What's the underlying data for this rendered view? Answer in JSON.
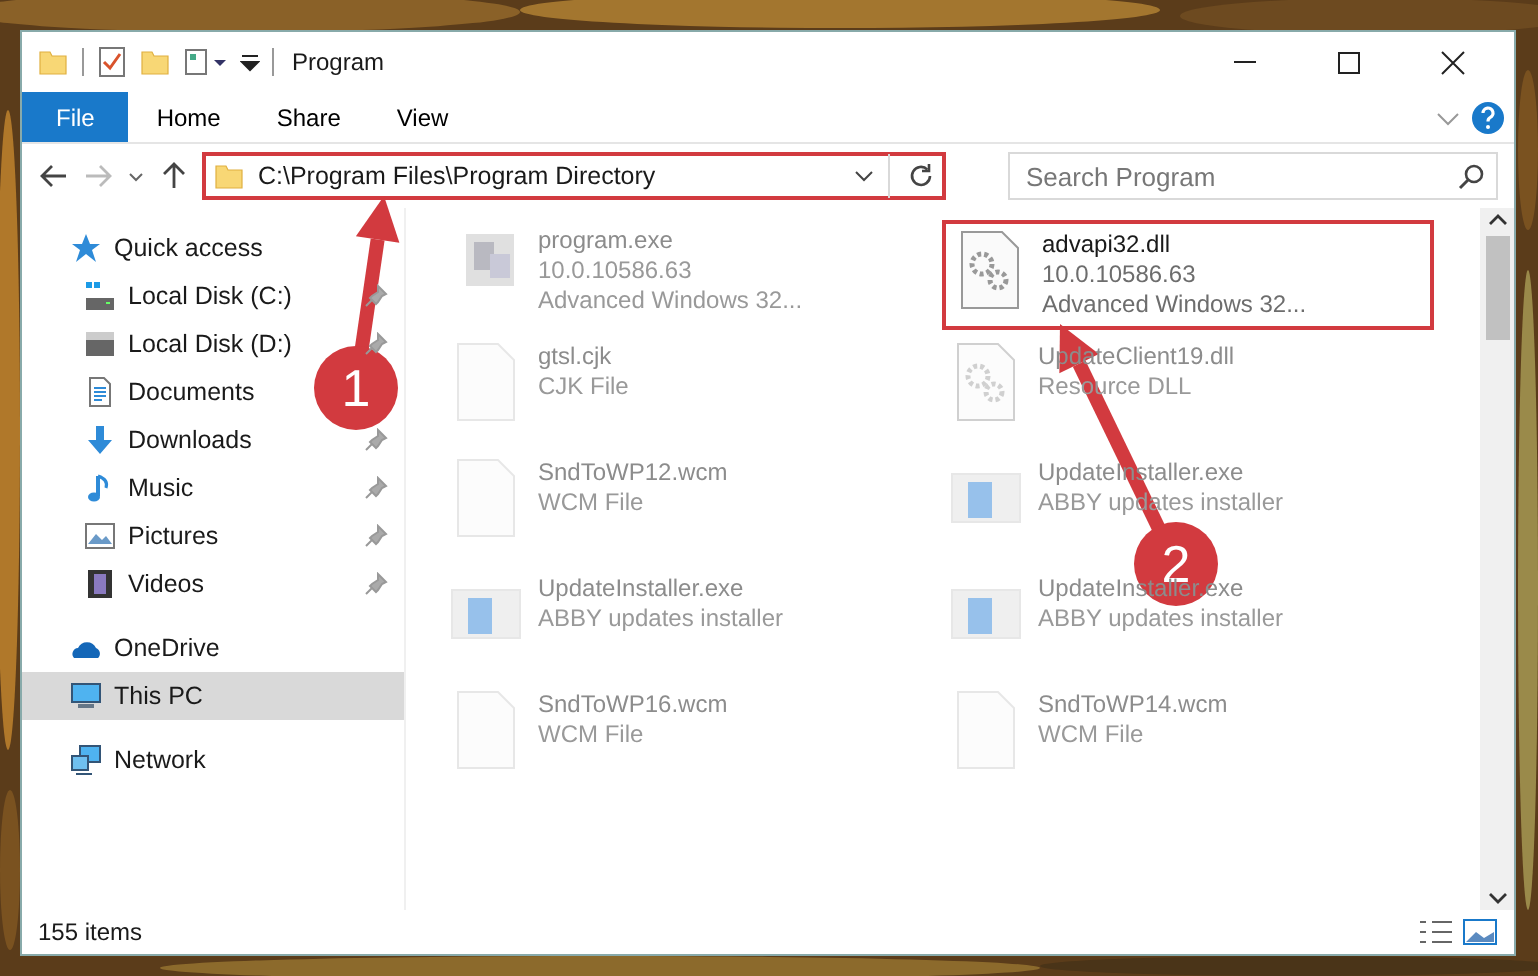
{
  "window": {
    "title": "Program"
  },
  "ribbon": {
    "tabs": [
      {
        "label": "File",
        "kind": "file"
      },
      {
        "label": "Home",
        "kind": "tab"
      },
      {
        "label": "Share",
        "kind": "tab"
      },
      {
        "label": "View",
        "kind": "tab"
      }
    ]
  },
  "address": {
    "path": "C:\\Program Files\\Program Directory",
    "placeholder": "Search Program",
    "highlighted": true
  },
  "sidebar": {
    "items": [
      {
        "label": "Quick access",
        "kind": "star",
        "selected": false,
        "children": [
          {
            "label": "Local Disk (C:)",
            "kind": "drive-c",
            "pinned": true,
            "selected": false
          },
          {
            "label": "Local Disk (D:)",
            "kind": "drive",
            "pinned": true,
            "selected": false
          },
          {
            "label": "Documents",
            "kind": "documents",
            "pinned": false,
            "selected": false
          },
          {
            "label": "Downloads",
            "kind": "downloads",
            "pinned": true,
            "selected": false
          },
          {
            "label": "Music",
            "kind": "music",
            "pinned": true,
            "selected": false
          },
          {
            "label": "Pictures",
            "kind": "pictures",
            "pinned": true,
            "selected": false
          },
          {
            "label": "Videos",
            "kind": "videos",
            "pinned": true,
            "selected": false
          }
        ]
      },
      {
        "label": "OneDrive",
        "kind": "cloud",
        "selected": false
      },
      {
        "label": "This PC",
        "kind": "pc",
        "selected": true
      },
      {
        "label": "Network",
        "kind": "network",
        "selected": false
      }
    ]
  },
  "files": [
    {
      "name": "program.exe",
      "details": [
        "10.0.10586.63",
        "Advanced Windows 32..."
      ],
      "kind": "exe",
      "highlighted": false
    },
    {
      "name": "advapi32.dll",
      "details": [
        "10.0.10586.63",
        "Advanced Windows 32..."
      ],
      "kind": "dll",
      "highlighted": true
    },
    {
      "name": "gtsl.cjk",
      "details": [
        "CJK File"
      ],
      "kind": "blank",
      "highlighted": false
    },
    {
      "name": "UpdateClient19.dll",
      "details": [
        "Resource DLL"
      ],
      "kind": "dll",
      "highlighted": false
    },
    {
      "name": "SndToWP12.wcm",
      "details": [
        "WCM File"
      ],
      "kind": "blank",
      "highlighted": false
    },
    {
      "name": "UpdateInstaller.exe",
      "details": [
        "ABBY updates installer"
      ],
      "kind": "installer",
      "highlighted": false
    },
    {
      "name": "UpdateInstaller.exe",
      "details": [
        "ABBY updates installer"
      ],
      "kind": "installer",
      "highlighted": false
    },
    {
      "name": "UpdateInstaller.exe",
      "details": [
        "ABBY updates installer"
      ],
      "kind": "installer",
      "highlighted": false
    },
    {
      "name": "SndToWP16.wcm",
      "details": [
        "WCM File"
      ],
      "kind": "blank",
      "highlighted": false
    },
    {
      "name": "SndToWP14.wcm",
      "details": [
        "WCM File"
      ],
      "kind": "blank",
      "highlighted": false
    }
  ],
  "status_bar": {
    "count": "155 items"
  },
  "annotations": [
    {
      "label": "1"
    },
    {
      "label": "2"
    }
  ]
}
